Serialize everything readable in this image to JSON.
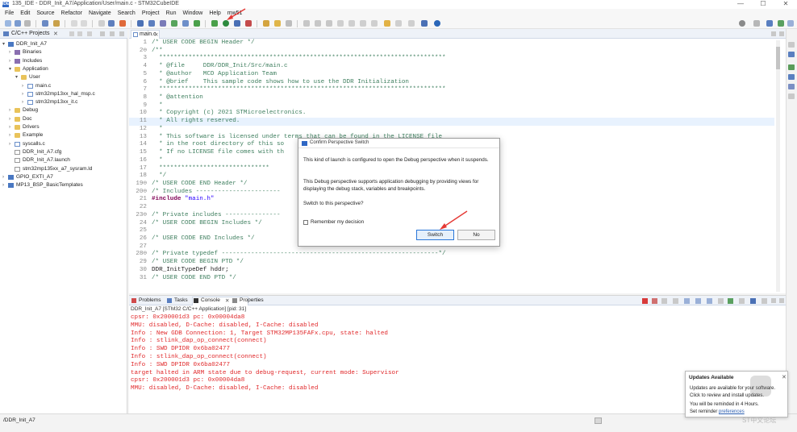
{
  "window": {
    "title": "135_IDE - DDR_Init_A7/Application/User/main.c - STM32CubeIDE",
    "app_icon": "IDE",
    "minimize": "—",
    "maximize": "☐",
    "close": "✕"
  },
  "menu": [
    "File",
    "Edit",
    "Source",
    "Refactor",
    "Navigate",
    "Search",
    "Project",
    "Run",
    "Window",
    "Help",
    "mw51"
  ],
  "project_explorer": {
    "tab_label": "C/C++ Projects",
    "tree": [
      {
        "label": "DDR_Init_A7",
        "icon": "project",
        "depth": 0,
        "twisty": "▾"
      },
      {
        "label": "Binaries",
        "icon": "lib",
        "depth": 1,
        "twisty": "›"
      },
      {
        "label": "Includes",
        "icon": "lib",
        "depth": 1,
        "twisty": "›"
      },
      {
        "label": "Application",
        "icon": "folder",
        "depth": 1,
        "twisty": "▾"
      },
      {
        "label": "User",
        "icon": "folder",
        "depth": 2,
        "twisty": "▾"
      },
      {
        "label": "main.c",
        "icon": "file-c",
        "depth": 3,
        "twisty": "›"
      },
      {
        "label": "stm32mp13xx_hal_msp.c",
        "icon": "file-c",
        "depth": 3,
        "twisty": "›"
      },
      {
        "label": "stm32mp13xx_it.c",
        "icon": "file-c",
        "depth": 3,
        "twisty": "›"
      },
      {
        "label": "Debug",
        "icon": "folder",
        "depth": 1,
        "twisty": "›"
      },
      {
        "label": "Doc",
        "icon": "folder",
        "depth": 1,
        "twisty": "›"
      },
      {
        "label": "Drivers",
        "icon": "folder",
        "depth": 1,
        "twisty": "›"
      },
      {
        "label": "Example",
        "icon": "folder",
        "depth": 1,
        "twisty": "›"
      },
      {
        "label": "syscalls.c",
        "icon": "file-c",
        "depth": 1,
        "twisty": "›"
      },
      {
        "label": "DDR_Init_A7.cfg",
        "icon": "file-g",
        "depth": 1,
        "twisty": ""
      },
      {
        "label": "DDR_Init_A7.launch",
        "icon": "file-g",
        "depth": 1,
        "twisty": ""
      },
      {
        "label": "stm32mp135xx_a7_sysram.ld",
        "icon": "file-g",
        "depth": 1,
        "twisty": ""
      },
      {
        "label": "GPIO_EXTI_A7",
        "icon": "project",
        "depth": 0,
        "twisty": "›"
      },
      {
        "label": "MP13_BSP_BasicTemplates",
        "icon": "project",
        "depth": 0,
        "twisty": "›"
      }
    ]
  },
  "editor": {
    "tab_label": "main.c",
    "lines": [
      {
        "n": "1",
        "text": "/* USER CODE BEGIN Header */",
        "kind": "com"
      },
      {
        "n": "2⊖",
        "text": "/**",
        "kind": "com"
      },
      {
        "n": "3",
        "text": "  ******************************************************************************",
        "kind": "com"
      },
      {
        "n": "4",
        "text": "  * @file     DDR/DDR_Init/Src/main.c",
        "kind": "com"
      },
      {
        "n": "5",
        "text": "  * @author   MCD Application Team",
        "kind": "com"
      },
      {
        "n": "6",
        "text": "  * @brief    This sample code shows how to use the DDR Initialization",
        "kind": "com"
      },
      {
        "n": "7",
        "text": "  ******************************************************************************",
        "kind": "com"
      },
      {
        "n": "8",
        "text": "  * @attention",
        "kind": "com"
      },
      {
        "n": "9",
        "text": "  *",
        "kind": "com"
      },
      {
        "n": "10",
        "text": "  * Copyright (c) 2021 STMicroelectronics.",
        "kind": "com"
      },
      {
        "n": "11",
        "text": "  * All rights reserved.",
        "kind": "com",
        "hl": true
      },
      {
        "n": "12",
        "text": "  *",
        "kind": "com"
      },
      {
        "n": "13",
        "text": "  * This software is licensed under terms that can be found in the LICENSE file",
        "kind": "com"
      },
      {
        "n": "14",
        "text": "  * in the root directory of this so",
        "kind": "com"
      },
      {
        "n": "15",
        "text": "  * If no LICENSE file comes with th",
        "kind": "com"
      },
      {
        "n": "16",
        "text": "  *",
        "kind": "com"
      },
      {
        "n": "17",
        "text": "  ******************************",
        "kind": "com"
      },
      {
        "n": "18",
        "text": "  */",
        "kind": "com"
      },
      {
        "n": "19⊖",
        "text": "/* USER CODE END Header */",
        "kind": "com"
      },
      {
        "n": "20⊖",
        "text": "/* Includes -----------------------",
        "kind": "com"
      },
      {
        "n": "21",
        "text": "",
        "kind": "include"
      },
      {
        "n": "22",
        "text": "",
        "kind": "com"
      },
      {
        "n": "23⊖",
        "text": "/* Private includes ---------------",
        "kind": "com"
      },
      {
        "n": "24",
        "text": "/* USER CODE BEGIN Includes */",
        "kind": "com"
      },
      {
        "n": "25",
        "text": "",
        "kind": "com"
      },
      {
        "n": "26",
        "text": "/* USER CODE END Includes */",
        "kind": "com"
      },
      {
        "n": "27",
        "text": "",
        "kind": "com"
      },
      {
        "n": "28⊖",
        "text": "/* Private typedef -----------------------------------------------------------*/",
        "kind": "com"
      },
      {
        "n": "29",
        "text": "/* USER CODE BEGIN PTD */",
        "kind": "com"
      },
      {
        "n": "30",
        "text": "DDR_InitTypeDef hddr;",
        "kind": "norm"
      },
      {
        "n": "31",
        "text": "/* USER CODE END PTD */",
        "kind": "com"
      }
    ],
    "include_directive": "#include",
    "include_file": " \"main.h\""
  },
  "console": {
    "tabs": [
      "Problems",
      "Tasks",
      "Console",
      "Properties"
    ],
    "title": "DDR_Init_A7 [STM32 C/C++ Application]  [pid: 31]",
    "lines": [
      "cpsr: 0x200001d3 pc: 0x00004da8",
      "MMU: disabled, D-Cache: disabled, I-Cache: disabled",
      "Info : New GDB Connection: 1, Target STM32MP135FAFx.cpu, state: halted",
      "Info : stlink_dap_op_connect(connect)",
      "Info : SWD DPIDR 0x6ba02477",
      "Info : stlink_dap_op_connect(connect)",
      "Info : SWD DPIDR 0x6ba02477",
      "target halted in ARM state due to debug-request, current mode: Supervisor",
      "cpsr: 0x200001d3 pc: 0x00004da8",
      "MMU: disabled, D-Cache: disabled, I-Cache: disabled"
    ]
  },
  "status_bar": {
    "path": "/DDR_Init_A7"
  },
  "dialog": {
    "title": "Confirm Perspective Switch",
    "text1": "This kind of launch is configured to open the Debug perspective when it suspends.",
    "text2": "This Debug perspective supports application debugging by providing views for displaying the debug stack, variables and breakpoints.",
    "question": "Switch to this perspective?",
    "remember_label": "Remember my decision",
    "switch_label": "Switch",
    "no_label": "No"
  },
  "updates": {
    "title": "Updates Available",
    "close": "✕",
    "line1": "Updates are available for your software.",
    "line2": "Click to review and install updates.",
    "line3": "You will be reminded in 4 Hours.",
    "line4_prefix": "Set reminder ",
    "line4_link": "preferences"
  },
  "watermark": "ST中文论坛",
  "colors": {
    "accent": "#2a77d9",
    "comment": "#3f7f5f",
    "console_error": "#e0282a",
    "arrow": "#e53935"
  }
}
